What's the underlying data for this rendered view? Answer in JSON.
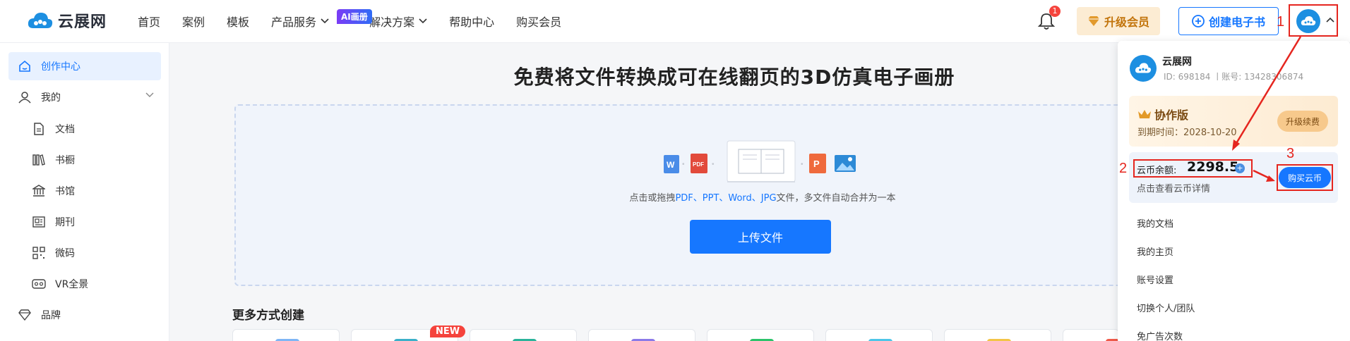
{
  "header": {
    "logo_text": "云展网",
    "nav": [
      {
        "label": "首页"
      },
      {
        "label": "案例"
      },
      {
        "label": "模板"
      },
      {
        "label": "产品服务"
      },
      {
        "label": "解决方案"
      },
      {
        "label": "帮助中心"
      },
      {
        "label": "购买会员"
      }
    ],
    "ai_badge": "AI画册",
    "notification_count": "1",
    "upgrade_label": "升级会员",
    "create_label": "创建电子书"
  },
  "annotations": {
    "n1": "1",
    "n2": "2",
    "n3": "3"
  },
  "sidebar": {
    "items": [
      {
        "label": "创作中心",
        "icon": "home-icon",
        "active": true
      },
      {
        "label": "我的",
        "icon": "user-icon"
      },
      {
        "label": "文档",
        "icon": "document-icon"
      },
      {
        "label": "书橱",
        "icon": "bookshelf-icon"
      },
      {
        "label": "书馆",
        "icon": "library-icon"
      },
      {
        "label": "期刊",
        "icon": "journal-icon"
      },
      {
        "label": "微码",
        "icon": "qrcode-icon"
      },
      {
        "label": "VR全景",
        "icon": "vr-icon"
      },
      {
        "label": "品牌",
        "icon": "diamond-icon"
      }
    ]
  },
  "main": {
    "title": "免费将文件转换成可在线翻页的3D仿真电子画册",
    "hint_prefix": "点击或拖拽",
    "hint_formats": "PDF、PPT、Word、JPG",
    "hint_suffix": "文件，多文件自动合并为一本",
    "upload_label": "上传文件",
    "more_title": "更多方式创建",
    "new_badge": "NEW"
  },
  "dropdown": {
    "name": "云展网",
    "id_line": "ID: 698184 丨账号: 13428306874",
    "vip_title": "协作版",
    "vip_expire": "到期时间：2028-10-20",
    "vip_renew": "升级续费",
    "coin_label": "云币余额:",
    "coin_value": "2298.5",
    "coin_detail": "点击查看云币详情",
    "buy_label": "购买云币",
    "menu": [
      {
        "label": "我的文档"
      },
      {
        "label": "我的主页"
      },
      {
        "label": "账号设置"
      },
      {
        "label": "切换个人/团队"
      },
      {
        "label": "免广告次数"
      }
    ]
  },
  "colors": {
    "primary": "#1677ff",
    "annotation": "#e5261f",
    "gold": "#c2740b"
  }
}
